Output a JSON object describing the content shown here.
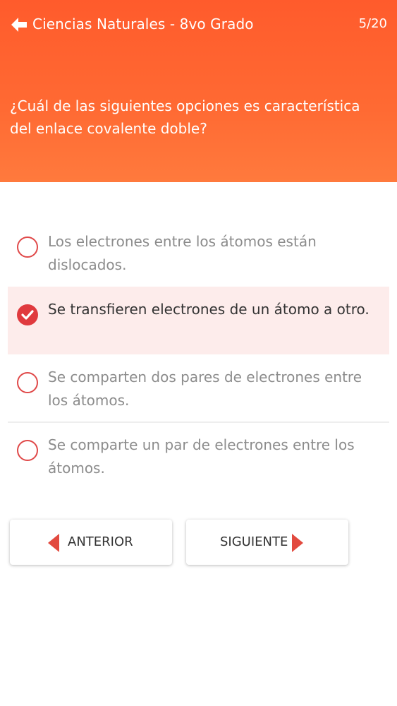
{
  "header": {
    "title": "Ciencias Naturales - 8vo Grado",
    "progress": "5/20",
    "question": "¿Cuál de las siguientes opciones es característica del enlace covalente doble?",
    "colors": {
      "accent": "#ff5b2c",
      "accent_light": "#ff7a3d"
    }
  },
  "options": [
    {
      "label": "Los electrones entre los átomos están dislocados.",
      "selected": false
    },
    {
      "label": "Se transfieren electrones de un átomo a otro.",
      "selected": true
    },
    {
      "label": "Se comparten dos pares de electrones entre los átomos.",
      "selected": false
    },
    {
      "label": "Se comparte un par de electrones entre los átomos.",
      "selected": false
    }
  ],
  "navigation": {
    "prev_label": "ANTERIOR",
    "next_label": "SIGUIENTE",
    "arrow_color": "#e24a3f"
  },
  "icons": {
    "back": "back-arrow-icon",
    "radio": "radio-icon",
    "check": "check-icon",
    "prev": "triangle-left-icon",
    "next": "triangle-right-icon"
  }
}
